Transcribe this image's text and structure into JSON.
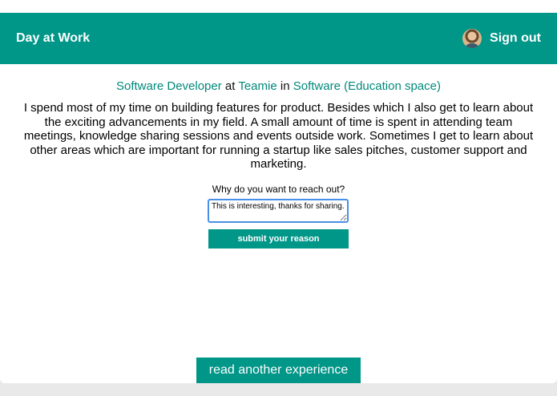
{
  "header": {
    "brand": "Day at Work",
    "signout_label": "Sign out",
    "avatar_icon": "user-avatar"
  },
  "profile": {
    "role": "Software Developer",
    "at_word": "at",
    "company": "Teamie",
    "in_word": "in",
    "industry": "Software (Education space)"
  },
  "description": "I spend most of my time on building features for product. Besides which I also get to learn about the exciting advancements in my field. A small amount of time is spent in attending team meetings, knowledge sharing sessions and events outside work. Sometimes I get to learn about other areas which are important for running a startup like sales pitches, customer support and marketing.",
  "reason": {
    "label": "Why do you want to reach out?",
    "value": "This is interesting, thanks for sharing.",
    "submit_label": "submit your reason"
  },
  "footer": {
    "another_label": "read another experience"
  },
  "colors": {
    "accent": "#009688",
    "link_text": "#00897b"
  }
}
